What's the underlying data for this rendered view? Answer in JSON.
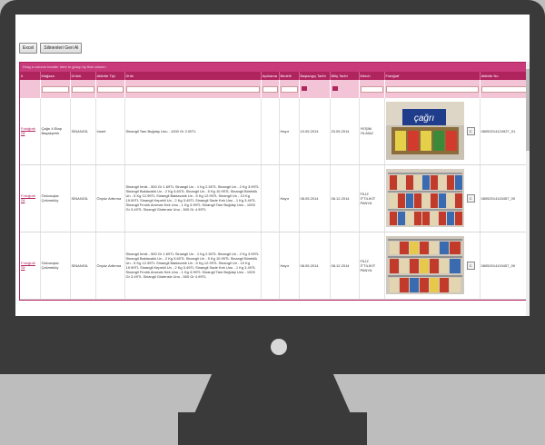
{
  "toolbar": {
    "excel": "Excel",
    "restore_deleted": "Silinenleri Geri Al"
  },
  "grid": {
    "group_hint": "Drag a column header here to group by that column",
    "columns": [
      "#",
      "Mağaza",
      "Ürünü",
      "Aktivite Tipi",
      "Ürün",
      "Açıklama",
      "Bedelli",
      "Başlangıç Tarihi",
      "Bitiş Tarihi",
      "Merch",
      "Fotoğraf",
      "Aktivite No"
    ],
    "photo_link": "Fotoğrafı",
    "delete_link": "Sil",
    "copy_btn": "C",
    "rows": [
      {
        "store": "Çağrı 4.Etap Başakşehir",
        "brand": "SİNANGİL",
        "type": "İnsert",
        "product": "Sinangil Tam Buğday Unu - 1000 Gr 2.00TL",
        "desc": "",
        "paid": "Hayır",
        "start": "10.05.2014",
        "end": "20.05.2014",
        "merch": "YEŞİM YILMAZ",
        "activity_no": "08052014124927_01"
      },
      {
        "store": "Özkuruşlar Çekmeköy",
        "brand": "SİNANGİL",
        "type": "Önyüz Arttırma",
        "product": "Sinangil İrmik - 500 Gr 1.69TL Sinangil Un - 1 Kg 2.50TL Sinangil Un - 2 Kg 3.99TL Sinangil Baklavalık Un - 2 Kg 5.60TL Sinangil Un - 5 Kg 10.99TL Sinangil Böreklik Un - 5 Kg 12.99TL Sinangil Baklavalık Un - 5 Kg 12.99TL Sinangil Un - 10 Kg 19.99TL Sinangil Kepekli Un - 2 Kg 3.49TL Sinangil Sade Kek Unu - 1 Kg 3.49TL Sinangil Fındık Aromalı Kek Unu - 1 Kg 3.99TL Sinangil Tam Buğday Unu - 1000 Gr 3.49TL Sinangil Glutensiz Unu - 500 Gr 4.99TL",
        "desc": "",
        "paid": "Hayır",
        "start": "08.05.2014",
        "end": "08.12.2014",
        "merch": "FİLİZ İTTİLİKİT PANYA",
        "activity_no": "08052014115457_09"
      },
      {
        "store": "Özkuruşlar Çekmeköy",
        "brand": "SİNANGİL",
        "type": "Önyüz Arttırma",
        "product": "Sinangil İrmik - 500 Gr 1.69TL Sinangil Un - 1 Kg 2.50TL Sinangil Un - 2 Kg 3.99TL Sinangil Baklavalık Un - 2 Kg 5.60TL Sinangil Un - 5 Kg 10.99TL Sinangil Böreklik Un - 5 Kg 12.99TL Sinangil Baklavalık Un - 5 Kg 12.99TL Sinangil Un - 10 Kg 19.99TL Sinangil Kepekli Un - 2 Kg 3.49TL Sinangil Sade Kek Unu - 1 Kg 3.49TL Sinangil Fındık Aromalı Kek Unu - 1 Kg 3.99TL Sinangil Tam Buğday Unu - 1000 Gr 3.49TL Sinangil Glutensiz Unu - 500 Gr 4.99TL",
        "desc": "",
        "paid": "Hayır",
        "start": "08.05.2014",
        "end": "08.12.2014",
        "merch": "FİLİZ İTTİLİKİT PANYA",
        "activity_no": "08052014115457_09"
      }
    ]
  },
  "photo1_logo": "çağrı",
  "colors": {
    "accent": "#b0245e",
    "frame": "#3a3a3a",
    "background": "#bdbdbd"
  }
}
